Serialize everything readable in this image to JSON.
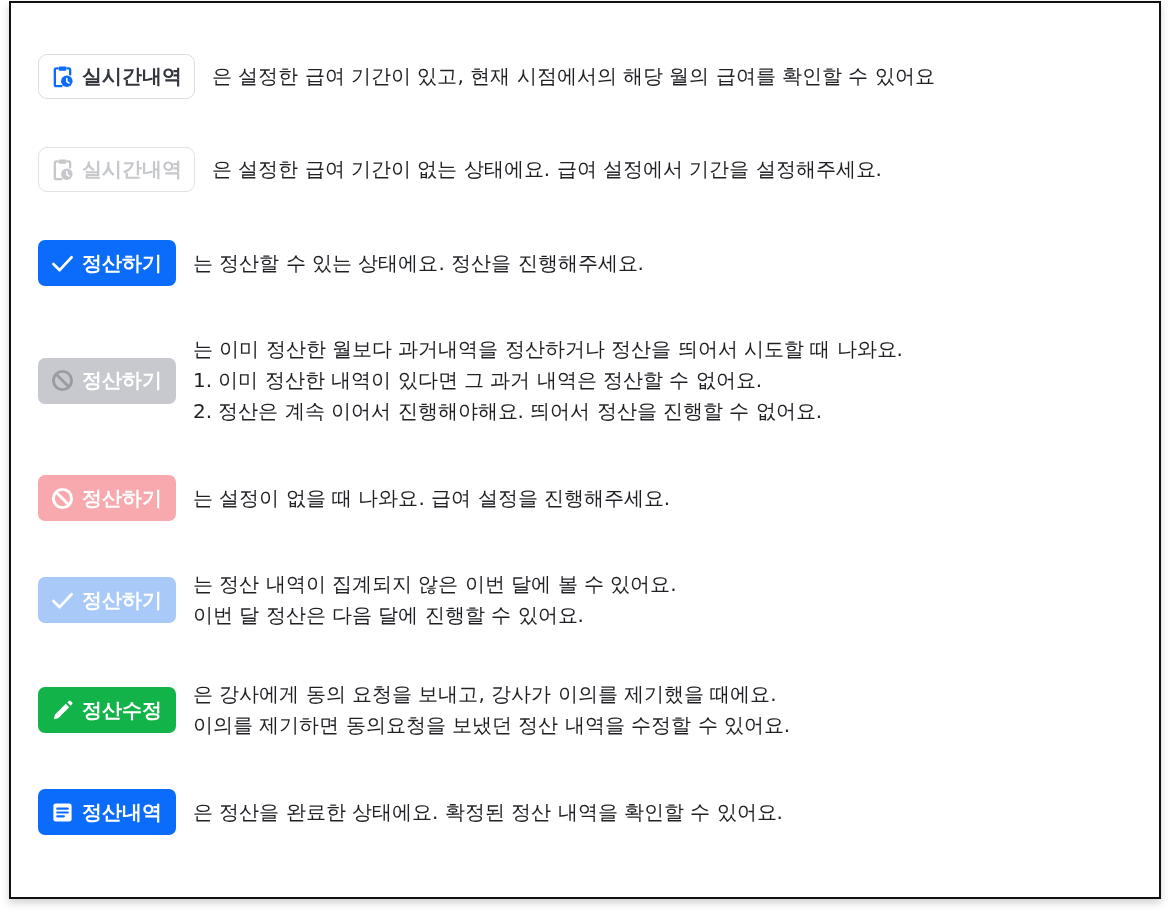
{
  "rows": [
    {
      "button": {
        "label": "실시간내역",
        "kind": "history",
        "disabled": false
      },
      "lines": [
        "은 설정한 급여 기간이 있고, 현재 시점에서의 해당 월의 급여를 확인할 수 있어요"
      ]
    },
    {
      "button": {
        "label": "실시간내역",
        "kind": "history",
        "disabled": true
      },
      "lines": [
        "은 설정한 급여 기간이 없는 상태에요. 급여 설정에서 기간을 설정해주세요."
      ]
    },
    {
      "button": {
        "label": "정산하기",
        "kind": "settle",
        "disabled": false
      },
      "lines": [
        "는 정산할 수 있는 상태에요. 정산을 진행해주세요."
      ]
    },
    {
      "button": {
        "label": "정산하기",
        "kind": "locked",
        "disabled": true
      },
      "lines": [
        "는 이미 정산한 월보다 과거내역을 정산하거나 정산을 띄어서 시도할 때 나와요.",
        "1. 이미 정산한 내역이 있다면 그 과거 내역은 정산할 수 없어요.",
        "2. 정산은 계속 이어서 진행해야해요. 띄어서 정산을 진행할 수 없어요."
      ]
    },
    {
      "button": {
        "label": "정산하기",
        "kind": "unset",
        "disabled": true
      },
      "lines": [
        "는 설정이 없을 때 나와요. 급여 설정을 진행해주세요."
      ]
    },
    {
      "button": {
        "label": "정산하기",
        "kind": "settle",
        "disabled": true
      },
      "lines": [
        "는 정산 내역이 집계되지 않은 이번 달에 볼 수 있어요.",
        "이번 달 정산은 다음 달에 진행할 수 있어요."
      ]
    },
    {
      "button": {
        "label": "정산수정",
        "kind": "edit",
        "disabled": false
      },
      "lines": [
        "은 강사에게 동의 요청을 보내고, 강사가 이의를 제기했을 때에요.",
        "이의를 제기하면 동의요청을 보냈던 정산 내역을 수정할 수 있어요."
      ]
    },
    {
      "button": {
        "label": "정산내역",
        "kind": "statement",
        "disabled": false
      },
      "lines": [
        "은 정산을 완료한 상태에요. 확정된 정산 내역을 확인할 수 있어요."
      ]
    }
  ]
}
